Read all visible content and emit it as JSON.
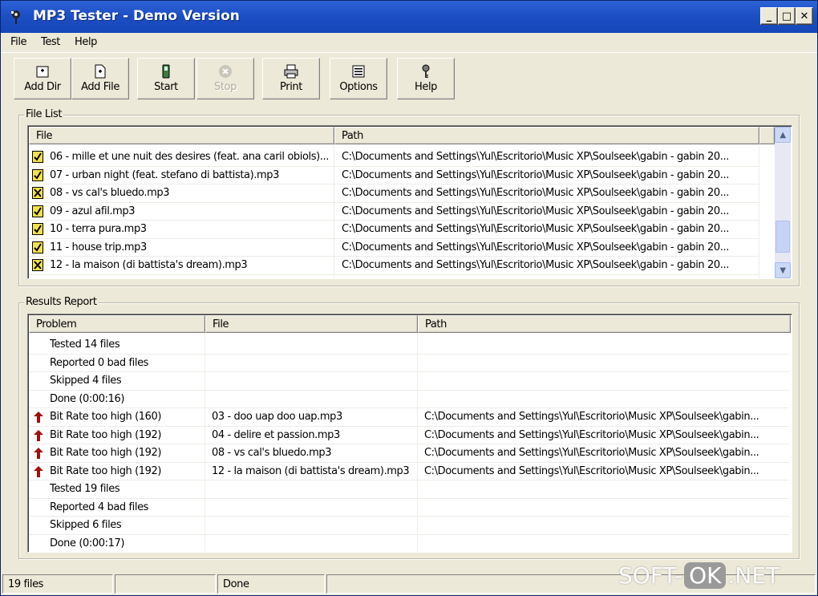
{
  "window": {
    "title": "MP3 Tester - Demo Version",
    "controls": {
      "minimize": "_",
      "maximize": "□",
      "close": "✕"
    }
  },
  "menu": [
    "File",
    "Test",
    "Help"
  ],
  "toolbar": [
    {
      "label": "Add Dir",
      "icon": "add-dir-icon",
      "enabled": true
    },
    {
      "label": "Add File",
      "icon": "add-file-icon",
      "enabled": true
    },
    {
      "label": "Start",
      "icon": "battery-icon",
      "enabled": true
    },
    {
      "label": "Stop",
      "icon": "stop-icon",
      "enabled": false
    },
    {
      "label": "Print",
      "icon": "printer-icon",
      "enabled": true
    },
    {
      "label": "Options",
      "icon": "options-icon",
      "enabled": true
    },
    {
      "label": "Help",
      "icon": "help-icon",
      "enabled": true
    }
  ],
  "file_list": {
    "group_title": "File List",
    "columns": [
      "File",
      "Path"
    ],
    "rows": [
      {
        "status": "ok",
        "file": "06 - mille et une nuit des desires (feat. ana caril obiols)...",
        "path": "C:\\Documents and Settings\\Yul\\Escritorio\\Music XP\\Soulseek\\gabin - gabin 20..."
      },
      {
        "status": "ok",
        "file": "07 - urban night (feat. stefano di battista).mp3",
        "path": "C:\\Documents and Settings\\Yul\\Escritorio\\Music XP\\Soulseek\\gabin - gabin 20..."
      },
      {
        "status": "bad",
        "file": "08 - vs cal's bluedo.mp3",
        "path": "C:\\Documents and Settings\\Yul\\Escritorio\\Music XP\\Soulseek\\gabin - gabin 20..."
      },
      {
        "status": "ok",
        "file": "09 - azul afil.mp3",
        "path": "C:\\Documents and Settings\\Yul\\Escritorio\\Music XP\\Soulseek\\gabin - gabin 20..."
      },
      {
        "status": "ok",
        "file": "10 - terra pura.mp3",
        "path": "C:\\Documents and Settings\\Yul\\Escritorio\\Music XP\\Soulseek\\gabin - gabin 20..."
      },
      {
        "status": "ok",
        "file": "11 - house trip.mp3",
        "path": "C:\\Documents and Settings\\Yul\\Escritorio\\Music XP\\Soulseek\\gabin - gabin 20..."
      },
      {
        "status": "bad",
        "file": "12 - la maison (di battista's dream).mp3",
        "path": "C:\\Documents and Settings\\Yul\\Escritorio\\Music XP\\Soulseek\\gabin - gabin 20..."
      }
    ]
  },
  "results": {
    "group_title": "Results Report",
    "columns": [
      "Problem",
      "File",
      "Path"
    ],
    "rows": [
      {
        "icon": "",
        "problem": "Tested 14 files",
        "file": "",
        "path": ""
      },
      {
        "icon": "",
        "problem": "Reported 0 bad files",
        "file": "",
        "path": ""
      },
      {
        "icon": "",
        "problem": "Skipped 4 files",
        "file": "",
        "path": ""
      },
      {
        "icon": "",
        "problem": "Done (0:00:16)",
        "file": "",
        "path": ""
      },
      {
        "icon": "up-arrow-icon",
        "problem": "Bit Rate too high (160)",
        "file": "03 - doo uap doo uap.mp3",
        "path": "C:\\Documents and Settings\\Yul\\Escritorio\\Music XP\\Soulseek\\gabin..."
      },
      {
        "icon": "up-arrow-icon",
        "problem": "Bit Rate too high (192)",
        "file": "04 - delire et passion.mp3",
        "path": "C:\\Documents and Settings\\Yul\\Escritorio\\Music XP\\Soulseek\\gabin..."
      },
      {
        "icon": "up-arrow-icon",
        "problem": "Bit Rate too high (192)",
        "file": "08 - vs cal's bluedo.mp3",
        "path": "C:\\Documents and Settings\\Yul\\Escritorio\\Music XP\\Soulseek\\gabin..."
      },
      {
        "icon": "up-arrow-icon",
        "problem": "Bit Rate too high (192)",
        "file": "12 - la maison (di battista's dream).mp3",
        "path": "C:\\Documents and Settings\\Yul\\Escritorio\\Music XP\\Soulseek\\gabin..."
      },
      {
        "icon": "",
        "problem": "Tested 19 files",
        "file": "",
        "path": ""
      },
      {
        "icon": "",
        "problem": "Reported 4 bad files",
        "file": "",
        "path": ""
      },
      {
        "icon": "",
        "problem": "Skipped 6 files",
        "file": "",
        "path": ""
      },
      {
        "icon": "",
        "problem": "Done (0:00:17)",
        "file": "",
        "path": ""
      }
    ]
  },
  "status_bar": [
    "19 files",
    "",
    "Done",
    ""
  ],
  "watermark": {
    "left": "SOFT-",
    "ok": "OK",
    "right": ".NET"
  },
  "colors": {
    "title_bar": "#1d4fc4",
    "window_bg": "#ece9d8",
    "bad_arrow": "#a01010",
    "ok_icon": "#f5e14a"
  }
}
